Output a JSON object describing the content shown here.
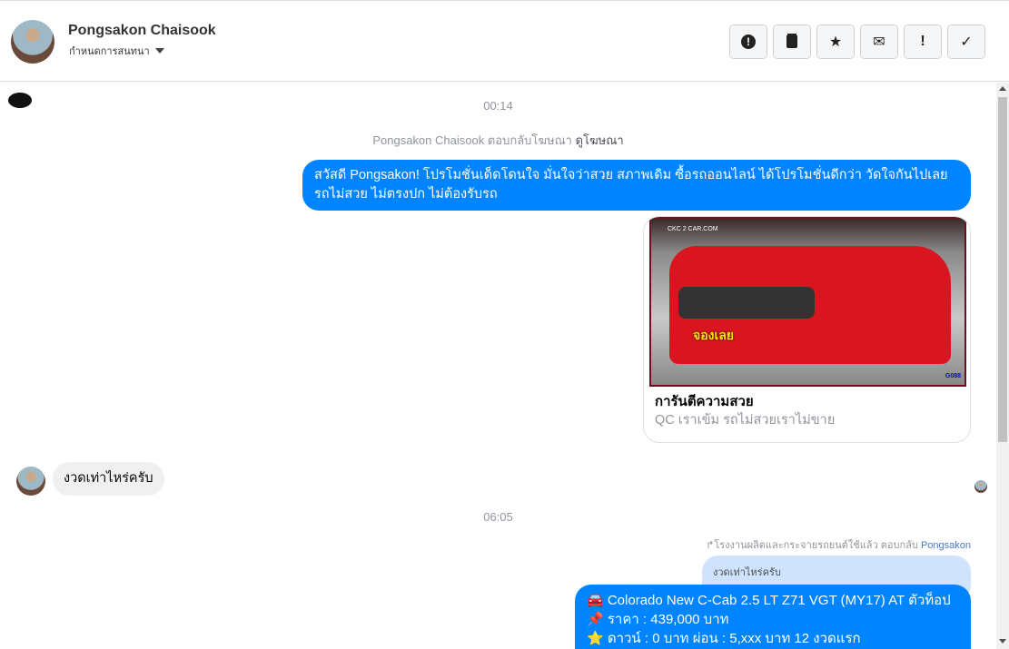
{
  "header": {
    "name": "Pongsakon Chaisook",
    "subtitle": "กำหนดการสนทนา",
    "actions": [
      {
        "icon": "alert-circle-icon",
        "glyph": "❗"
      },
      {
        "icon": "trash-icon",
        "glyph": "🗑"
      },
      {
        "icon": "star-icon",
        "glyph": "★"
      },
      {
        "icon": "envelope-icon",
        "glyph": "✉"
      },
      {
        "icon": "exclamation-icon",
        "glyph": "!"
      },
      {
        "icon": "check-icon",
        "glyph": "✓"
      }
    ]
  },
  "chat": {
    "time1": "00:14",
    "reply_note": {
      "text": "Pongsakon Chaisook ตอบกลับโฆษณา",
      "link": "ดูโฆษณา"
    },
    "msg1": "สวัสดี Pongsakon! โปรโมชั่นเด็ดโดนใจ มั่นใจว่าสวย สภาพเดิม ซื้อรถออนไลน์ ได้โปรโมชั่นดีกว่า วัดใจกันไปเลย รถไม่สวย ไม่ตรงปก ไม่ต้องรับรถ",
    "card": {
      "title": "การันตีความสวย",
      "subtitle": "QC เราเข้ม รถไม่สวยเราไม่ขาย",
      "image_badge": "จองเลย",
      "image_logo": "CKC 2 CAR.COM",
      "image_code": "G088"
    },
    "incoming": "งวดเท่าไหร่ครับ",
    "time2": "06:05",
    "forward_note": {
      "text": "โรงงานผลิตและกระจายรถยนต์ใช้แล้ว ตอบกลับ",
      "name": "Pongsakon"
    },
    "quoted": "งวดเท่าไหร่ครับ",
    "msg2_lines": [
      "🚘 Colorado New C-Cab 2.5 LT Z71 VGT (MY17) AT ตัวท็อป",
      "📌 ราคา : 439,000 บาท",
      "⭐ ดาวน์ : 0 บาท ผ่อน : 5,xxx บาท 12 งวดแรก"
    ]
  }
}
